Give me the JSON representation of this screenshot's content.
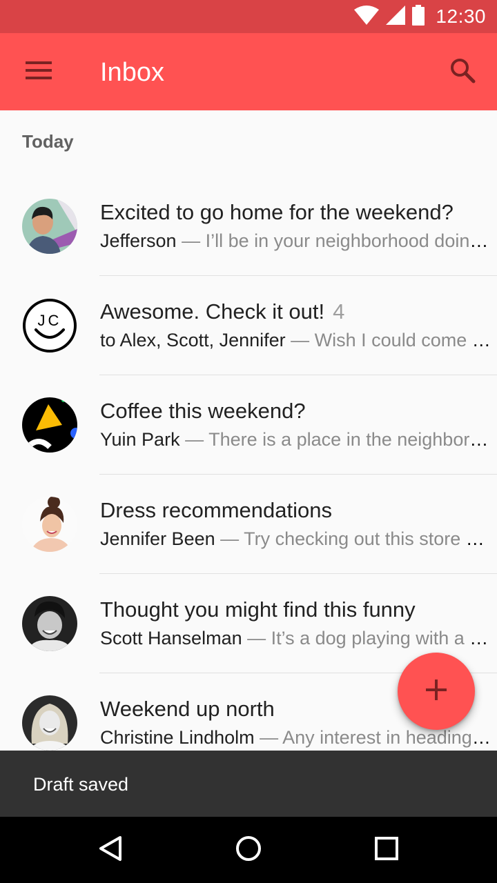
{
  "status_bar": {
    "time": "12:30",
    "icons": [
      "wifi-icon",
      "signal-icon",
      "battery-icon"
    ]
  },
  "app_bar": {
    "title": "Inbox",
    "menu_icon": "menu-icon",
    "search_icon": "search-icon"
  },
  "section": {
    "header": "Today"
  },
  "emails": [
    {
      "subject": "Excited to go home for the weekend?",
      "count": "",
      "sender": "Jefferson",
      "preview": " — I’ll be in your neighborhood doing errands this weekend",
      "avatar": "avatar-photo"
    },
    {
      "subject": "Awesome. Check it out!",
      "count": "4",
      "sender": "to Alex, Scott, Jennifer",
      "preview": " — Wish I could come but I'm out of town",
      "avatar": "avatar-jc-smiley"
    },
    {
      "subject": "Coffee this weekend?",
      "count": "",
      "sender": "Yuin Park",
      "preview": " — There is a place in the neighborhood we should try",
      "avatar": "avatar-graphic"
    },
    {
      "subject": "Dress recommendations",
      "count": "",
      "sender": "Jennifer Been",
      "preview": " — Try checking out this store downtown",
      "avatar": "avatar-photo"
    },
    {
      "subject": "Thought you might find this funny",
      "count": "",
      "sender": "Scott Hanselman",
      "preview": " — It’s a dog playing with a ball",
      "avatar": "avatar-photo"
    },
    {
      "subject": "Weekend up north",
      "count": "",
      "sender": "Christine Lindholm",
      "preview": " — Any interest in heading up north this weekend",
      "avatar": "avatar-photo"
    }
  ],
  "fab": {
    "icon": "plus-icon"
  },
  "snackbar": {
    "text": "Draft saved"
  },
  "nav_bar": {
    "icons": [
      "back-icon",
      "home-icon",
      "recents-icon"
    ]
  },
  "colors": {
    "primary": "#ff5252",
    "primary_dark": "#d94346",
    "snackbar": "#323232"
  }
}
